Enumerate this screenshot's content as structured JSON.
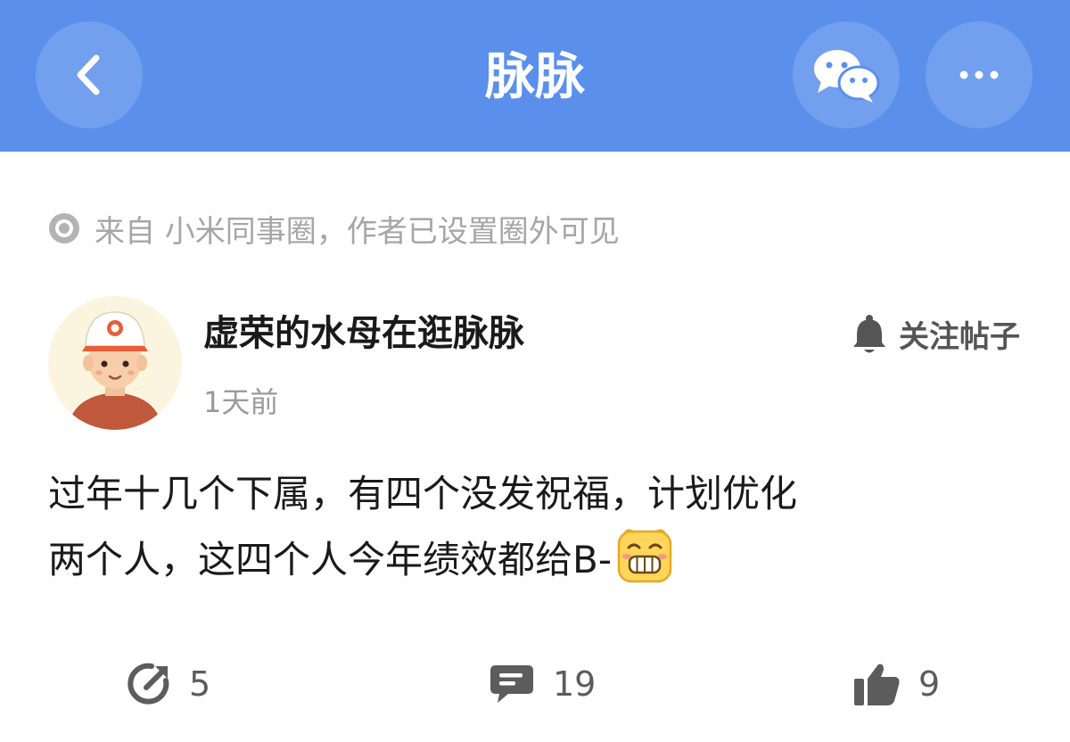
{
  "header": {
    "title": "脉脉",
    "bg_color": "#5a8fec"
  },
  "source": {
    "text": "来自 小米同事圈，作者已设置圈外可见"
  },
  "post": {
    "author": "虚荣的水母在逛脉脉",
    "time": "1天前",
    "follow_label": "关注帖子",
    "content_line1": "过年十几个下属，有四个没发祝福，计划优化",
    "content_line2": "两个人，这四个人今年绩效都给B-"
  },
  "actions": {
    "share_count": "5",
    "comment_count": "19",
    "like_count": "9"
  },
  "icons": [
    "back-icon",
    "wechat-icon",
    "more-icon",
    "source-dot-icon",
    "bell-icon",
    "share-icon",
    "comment-icon",
    "thumbs-up-icon",
    "grin-emoji-icon"
  ]
}
